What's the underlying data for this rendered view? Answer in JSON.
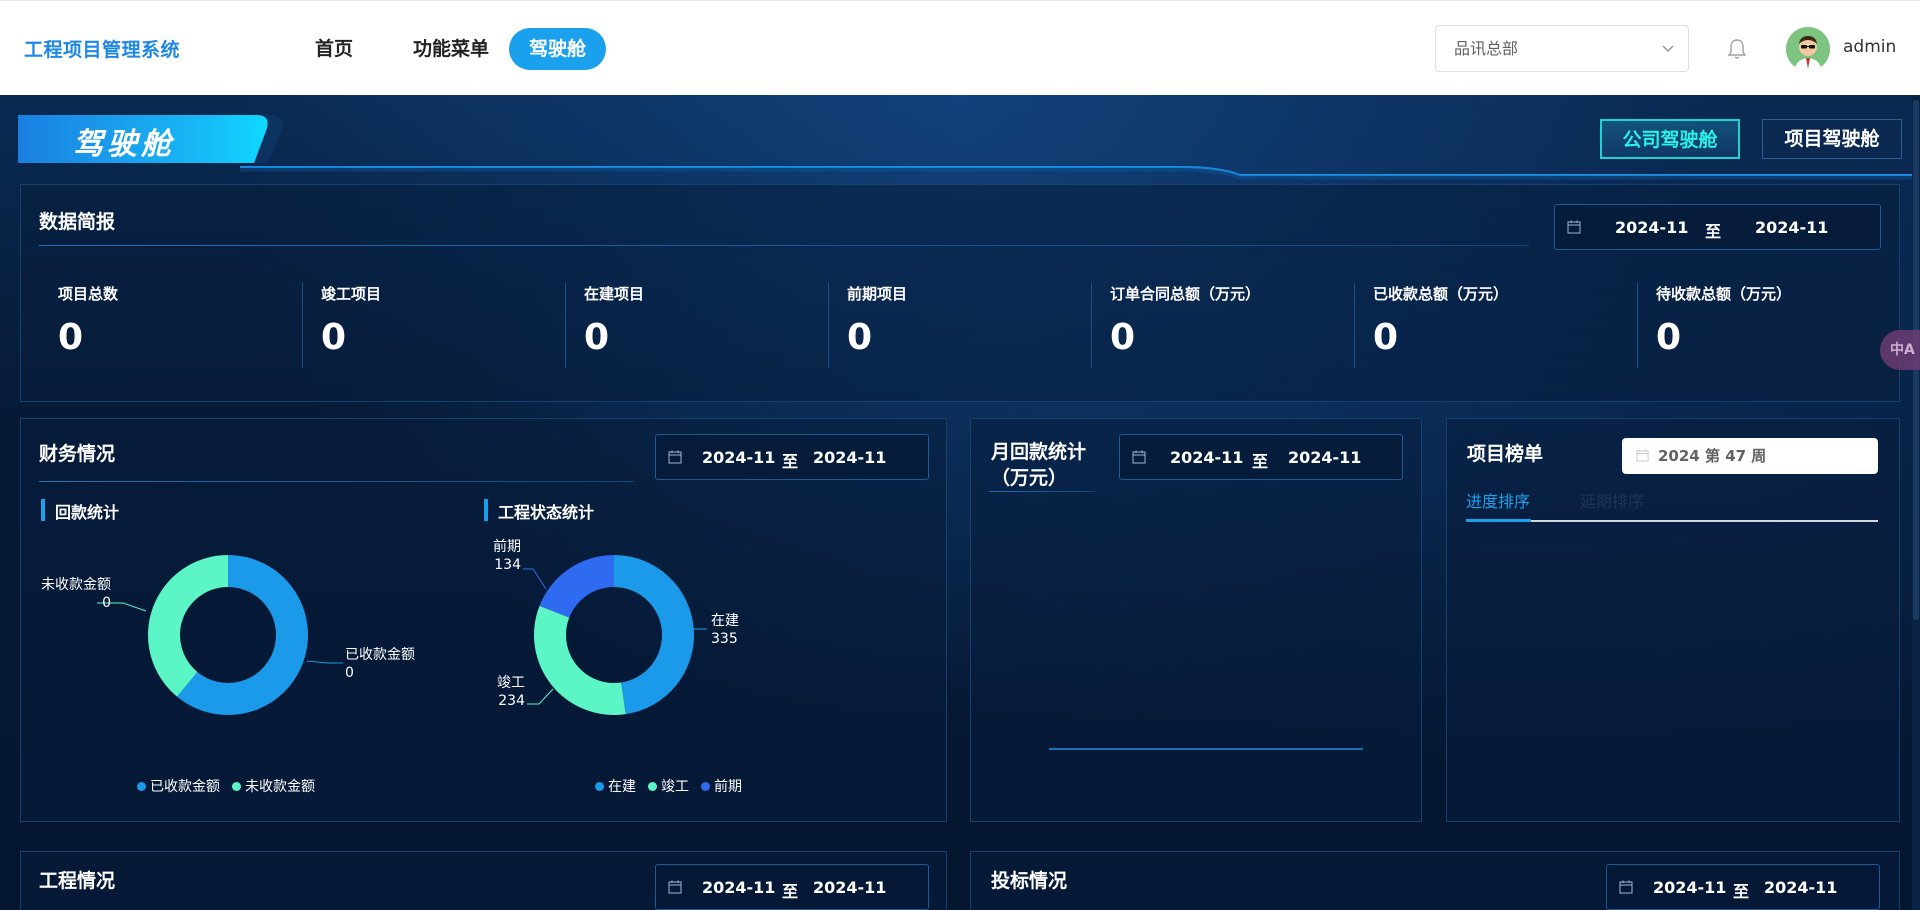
{
  "app": {
    "title": "工程项目管理系统"
  },
  "nav": {
    "items": [
      {
        "label": "首页"
      },
      {
        "label": "功能菜单"
      },
      {
        "label": "驾驶舱"
      }
    ],
    "active_index": 2
  },
  "org_select": {
    "value": "品讯总部"
  },
  "user": {
    "name": "admin"
  },
  "page": {
    "banner_title": "驾驶舱",
    "cockpit_tabs": [
      "公司驾驶舱",
      "项目驾驶舱"
    ],
    "cockpit_active_index": 0
  },
  "summary": {
    "title": "数据简报",
    "date_from": "2024-11",
    "date_sep": "至",
    "date_to": "2024-11",
    "stats": [
      {
        "label": "项目总数",
        "value": "0"
      },
      {
        "label": "竣工项目",
        "value": "0"
      },
      {
        "label": "在建项目",
        "value": "0"
      },
      {
        "label": "前期项目",
        "value": "0"
      },
      {
        "label": "订单合同总额（万元）",
        "value": "0"
      },
      {
        "label": "已收款总额（万元）",
        "value": "0"
      },
      {
        "label": "待收款总额（万元）",
        "value": "0"
      }
    ]
  },
  "finance": {
    "title": "财务情况",
    "date_from": "2024-11",
    "date_sep": "至",
    "date_to": "2024-11",
    "receipt_title": "回款统计",
    "status_title": "工程状态统计"
  },
  "monthly": {
    "title_line1": "月回款统计",
    "title_line2": "（万元）",
    "date_from": "2024-11",
    "date_sep": "至",
    "date_to": "2024-11"
  },
  "ranking": {
    "title": "项目榜单",
    "week_value": "2024 第 47 周",
    "tabs": [
      "进度排序",
      "延期排序"
    ],
    "active_tab": 0
  },
  "engineering": {
    "title": "工程情况",
    "date_from": "2024-11",
    "date_sep": "至",
    "date_to": "2024-11"
  },
  "bidding": {
    "title": "投标情况",
    "date_from": "2024-11",
    "date_sep": "至",
    "date_to": "2024-11"
  },
  "side_widget": {
    "label": "中A"
  },
  "colors": {
    "received": "#1a9ae8",
    "unreceived": "#5cf5c6",
    "in_progress": "#1a9ae8",
    "completed": "#5cf5c6",
    "early": "#2f6bf0",
    "accent": "#1aa0ec"
  },
  "chart_data": [
    {
      "type": "pie",
      "title": "回款统计",
      "categories": [
        "已收款金额",
        "未收款金额"
      ],
      "values": [
        0,
        0
      ],
      "legend": "bottom"
    },
    {
      "type": "pie",
      "title": "工程状态统计",
      "categories": [
        "在建",
        "竣工",
        "前期"
      ],
      "values": [
        335,
        234,
        134
      ],
      "legend": "bottom"
    }
  ]
}
